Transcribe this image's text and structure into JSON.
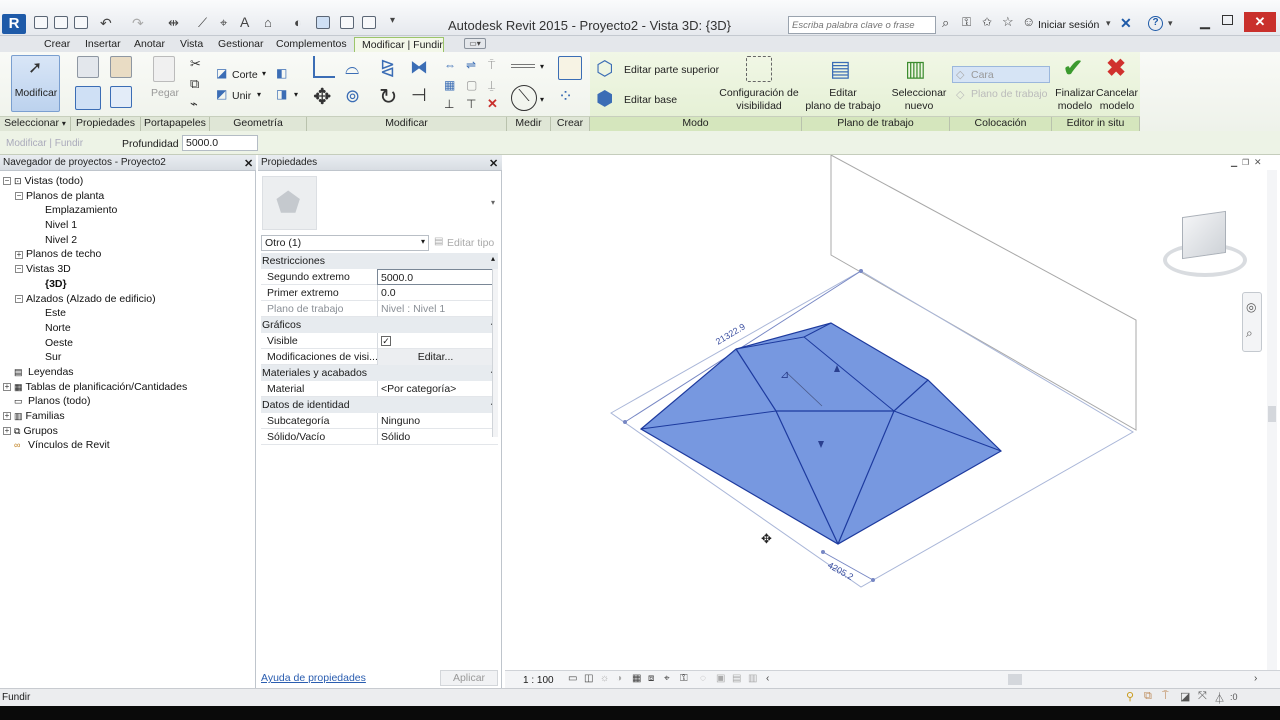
{
  "app": {
    "title": "Autodesk Revit 2015 -     Proyecto2 - Vista 3D: {3D}",
    "search_placeholder": "Escriba palabra clave o frase",
    "signin": "Iniciar sesión"
  },
  "tabs": [
    "Crear",
    "Insertar",
    "Anotar",
    "Vista",
    "Gestionar",
    "Complementos",
    "Modificar | Fundir"
  ],
  "ribbon": {
    "modificar": "Modificar",
    "pegar": "Pegar",
    "corte": "Corte",
    "unir": "Unir",
    "editar_parte_superior": "Editar parte superior",
    "editar_base": "Editar base",
    "config_visibilidad": [
      "Configuración de",
      "visibilidad"
    ],
    "editar_plano": [
      "Editar",
      "plano de trabajo"
    ],
    "seleccionar_nuevo": [
      "Seleccionar",
      "nuevo"
    ],
    "cara": "Cara",
    "plano_trabajo": "Plano de trabajo",
    "finalizar": [
      "Finalizar",
      "modelo"
    ],
    "cancelar": [
      "Cancelar",
      "modelo"
    ]
  },
  "groups": [
    "Seleccionar",
    "Propiedades",
    "Portapapeles",
    "Geometría",
    "Modificar",
    "Medir",
    "Crear",
    "Modo",
    "Plano de trabajo",
    "Colocación",
    "Editor in situ"
  ],
  "options": {
    "context": "Modificar | Fundir",
    "depth_label": "Profundidad",
    "depth_value": "5000.0"
  },
  "browser": {
    "title": "Navegador de proyectos - Proyecto2",
    "nodes": [
      {
        "label": "Vistas (todo)",
        "icon": "views-icon"
      },
      {
        "label": "Planos de planta"
      },
      {
        "label": "Emplazamiento"
      },
      {
        "label": "Nivel 1"
      },
      {
        "label": "Nivel 2"
      },
      {
        "label": "Planos de techo"
      },
      {
        "label": "Vistas 3D"
      },
      {
        "label": "{3D}"
      },
      {
        "label": "Alzados (Alzado de edificio)"
      },
      {
        "label": "Este"
      },
      {
        "label": "Norte"
      },
      {
        "label": "Oeste"
      },
      {
        "label": "Sur"
      },
      {
        "label": "Leyendas",
        "icon": "legend-icon"
      },
      {
        "label": "Tablas de planificación/Cantidades",
        "icon": "schedule-icon"
      },
      {
        "label": "Planos (todo)",
        "icon": "sheet-icon"
      },
      {
        "label": "Familias",
        "icon": "family-icon"
      },
      {
        "label": "Grupos",
        "icon": "group-icon"
      },
      {
        "label": "Vínculos de Revit",
        "icon": "link-icon"
      }
    ]
  },
  "properties": {
    "title": "Propiedades",
    "type_selector": "Otro (1)",
    "edit_type": "Editar tipo",
    "categories": [
      "Restricciones",
      "Gráficos",
      "Materiales y acabados",
      "Datos de identidad"
    ],
    "rows": [
      {
        "k": "Segundo extremo",
        "v": "5000.0"
      },
      {
        "k": "Primer extremo",
        "v": "0.0"
      },
      {
        "k": "Plano de trabajo",
        "v": "Nivel : Nivel 1"
      },
      {
        "k": "Visible",
        "v": "✓"
      },
      {
        "k": "Modificaciones de visi...",
        "v": "Editar..."
      },
      {
        "k": "Material",
        "v": "<Por categoría>"
      },
      {
        "k": "Subcategoría",
        "v": "Ninguno"
      },
      {
        "k": "Sólido/Vacío",
        "v": "Sólido"
      }
    ],
    "help_link": "Ayuda de propiedades",
    "apply": "Aplicar"
  },
  "viewport": {
    "dim_top": "21322.9",
    "dim_bottom": "4205.2",
    "scale": "1 : 100"
  },
  "status": {
    "text": "Fundir"
  },
  "colors": {
    "accent": "#3b6db5",
    "context_tab": "#9cc56a",
    "form_fill": "#6a8fdc"
  }
}
